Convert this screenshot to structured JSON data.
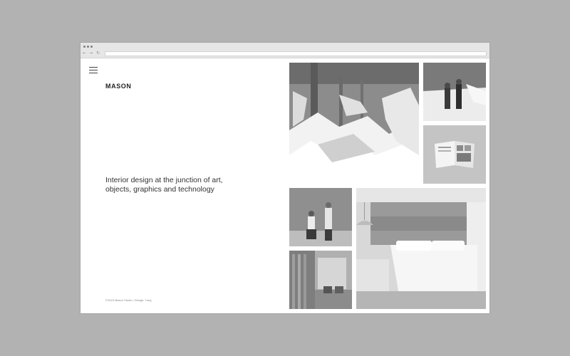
{
  "browser": {
    "url": ""
  },
  "site": {
    "logo": "MASON",
    "tagline_lines": [
      "Interior design at the junction of art,",
      "objects, graphics and technology"
    ],
    "footer": "©2015 Mason Studio  /  Design: Yung"
  },
  "gallery": [
    {
      "name": "cloud-installation-photo",
      "subject": "white crumpled paper cloud installation in a loft"
    },
    {
      "name": "snow-portrait-photo",
      "subject": "two people posing in snow in front of a brick wall"
    },
    {
      "name": "magazine-spread-photo",
      "subject": "open magazine on a grey surface"
    },
    {
      "name": "studio-portrait-photo",
      "subject": "two people posing in a photo studio"
    },
    {
      "name": "hotel-bedroom-photo",
      "subject": "hotel bedroom with pendant lamp and mural headboard"
    },
    {
      "name": "glass-lobby-photo",
      "subject": "interior with glass screens and lounge chairs"
    }
  ]
}
